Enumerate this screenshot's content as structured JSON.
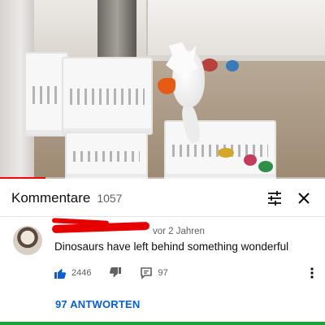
{
  "video": {
    "progress_fraction": 0.14,
    "progress_color": "#ff0000"
  },
  "comments_header": {
    "title": "Kommentare",
    "count": "1057",
    "sort_icon": "sort-sliders-icon",
    "close_icon": "close-icon"
  },
  "comment": {
    "author_redacted": true,
    "time": "vor 2 Jahren",
    "text": "Dinosaurs have left behind something wonderful",
    "likes": "2446",
    "replies_count": "97",
    "like_icon": "thumbs-up-icon",
    "dislike_icon": "thumbs-down-icon",
    "reply_icon": "reply-icon",
    "more_icon": "more-vert-icon",
    "replies_link": "97 ANTWORTEN"
  },
  "colors": {
    "link_blue": "#065fd4",
    "like_blue": "#065fd4",
    "redaction_red": "#e60000",
    "text_secondary": "#606060"
  }
}
